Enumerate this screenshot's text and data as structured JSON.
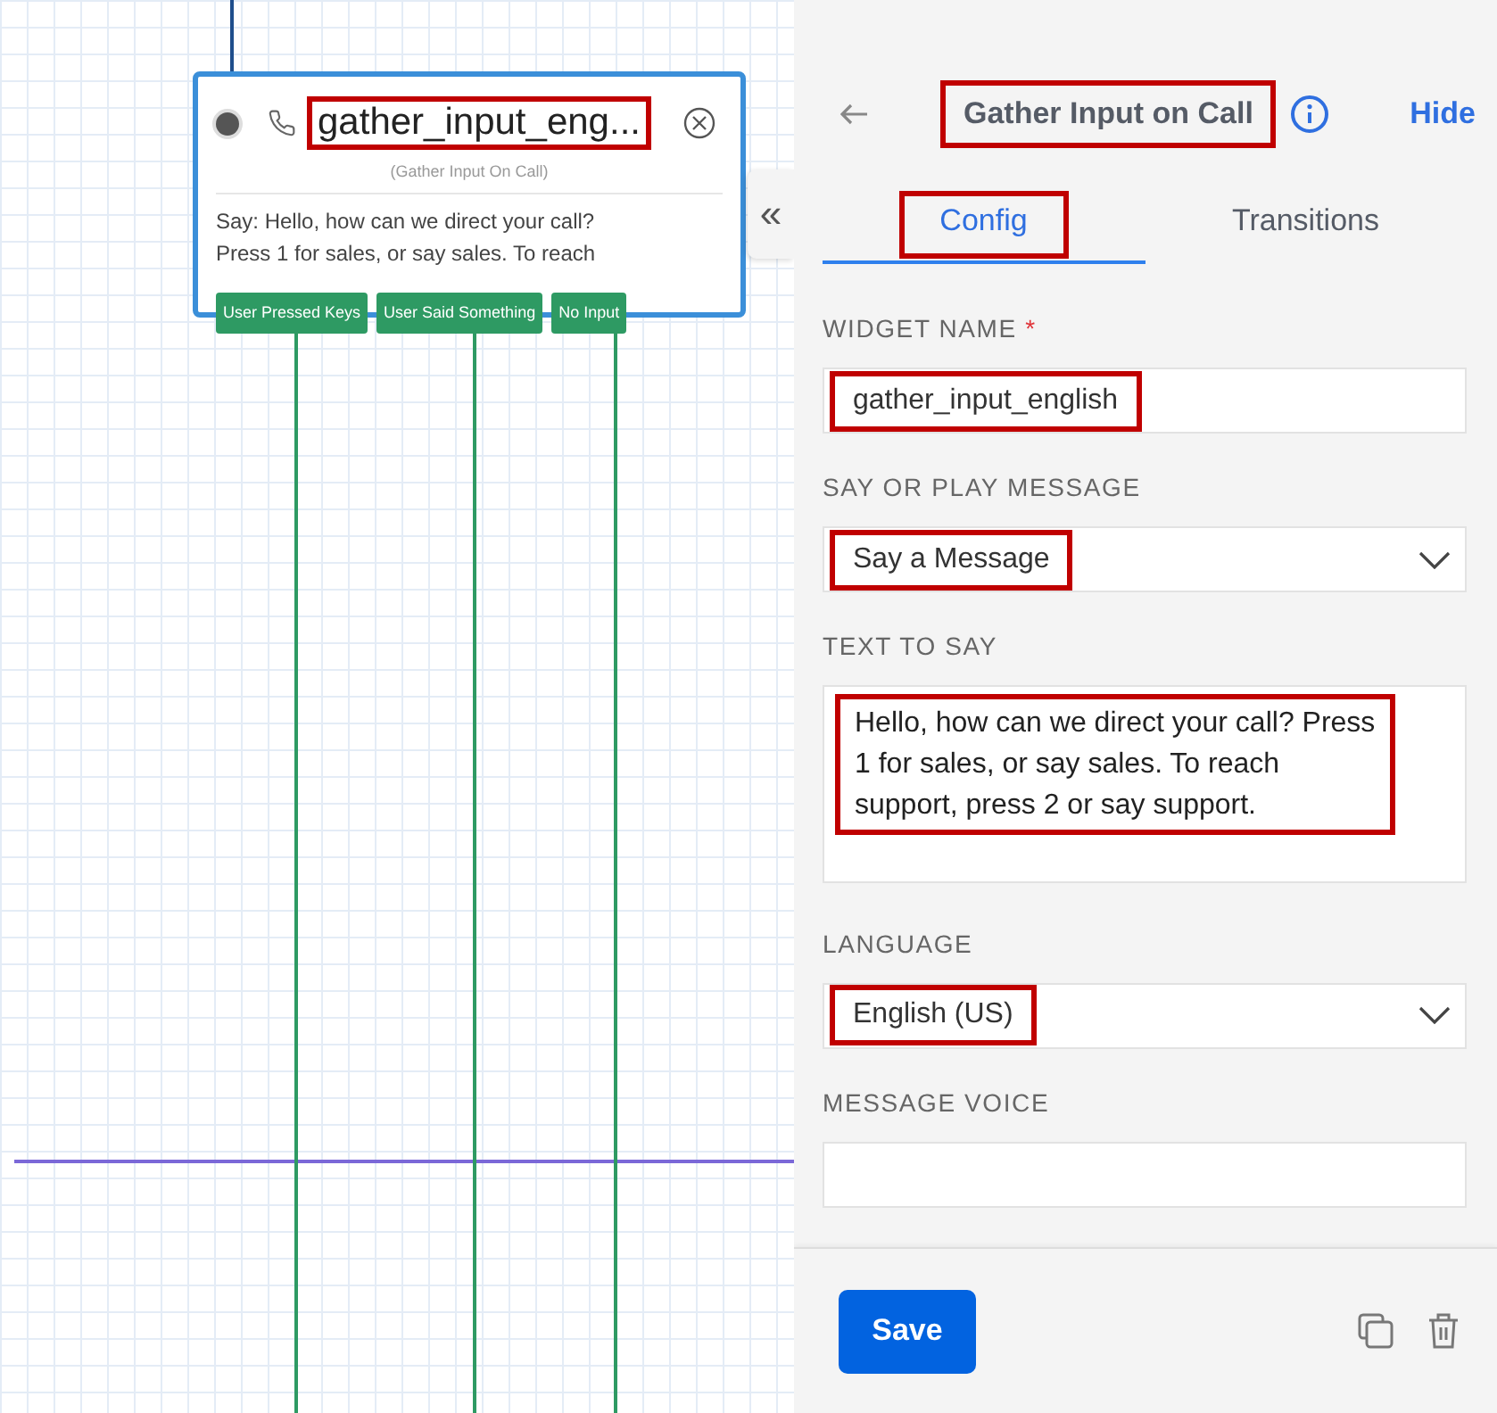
{
  "canvas": {
    "node": {
      "title": "gather_input_eng...",
      "title_highlighted": true,
      "subtitle": "(Gather Input On Call)",
      "body_lines": [
        "Say: Hello, how can we direct your call?",
        "Press 1 for sales, or say sales. To reach"
      ],
      "transitions": [
        "User Pressed Keys",
        "User Said Something",
        "No Input"
      ]
    },
    "collapse_button": "«"
  },
  "panel": {
    "title": "Gather Input on Call",
    "title_highlighted": true,
    "hide_link": "Hide",
    "tabs": [
      {
        "label": "Config",
        "selected": true,
        "highlighted": true
      },
      {
        "label": "Transitions",
        "selected": false,
        "highlighted": false
      }
    ],
    "fields": [
      {
        "kind": "input",
        "label": "WIDGET NAME",
        "required_mark": "*",
        "value": "gather_input_english",
        "highlighted": true
      },
      {
        "kind": "select",
        "label": "SAY OR PLAY MESSAGE",
        "value": "Say a Message",
        "highlighted": true
      },
      {
        "kind": "textarea",
        "label": "TEXT TO SAY",
        "value": "Hello, how can we direct your call? Press 1 for sales, or say sales. To reach support, press 2 or say support.",
        "highlighted": true
      },
      {
        "kind": "select",
        "label": "LANGUAGE",
        "value": "English (US)",
        "highlighted": true
      },
      {
        "kind": "input",
        "label": "MESSAGE VOICE"
      }
    ],
    "save_button": "Save"
  }
}
